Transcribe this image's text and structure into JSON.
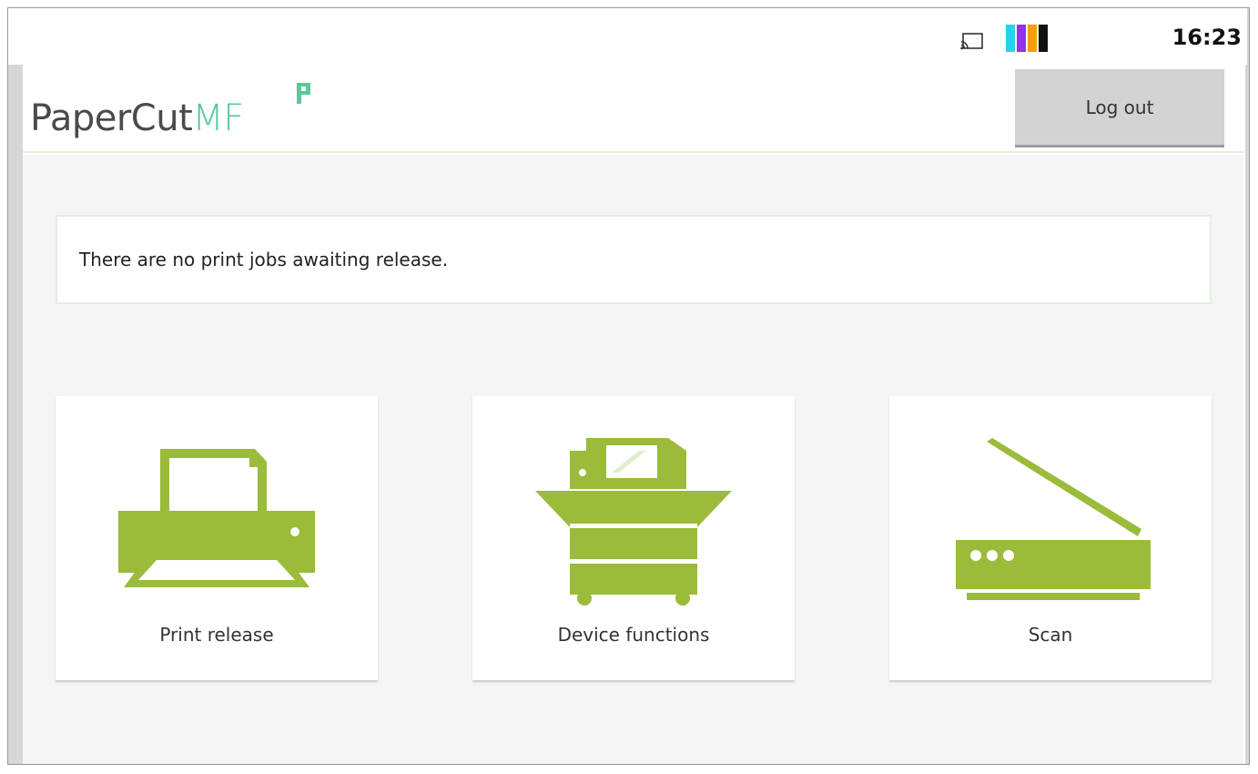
{
  "status_bar": {
    "time": "16:23",
    "cast_icon": "cast-icon",
    "toner_colors": [
      "#22d3ee",
      "#9333ea",
      "#f59e0b",
      "#111111"
    ]
  },
  "header": {
    "logo_text_main": "PaperCut",
    "logo_text_accent": "MF",
    "logout_label": "Log out"
  },
  "message": {
    "text": "There are no print jobs awaiting release."
  },
  "tiles": [
    {
      "label": "Print release",
      "icon": "printer-icon"
    },
    {
      "label": "Device functions",
      "icon": "copier-icon"
    },
    {
      "label": "Scan",
      "icon": "scanner-icon"
    }
  ],
  "colors": {
    "icon_green": "#9bbb3b",
    "logo_accent": "#5cc89a",
    "background": "#f5f5f5"
  }
}
